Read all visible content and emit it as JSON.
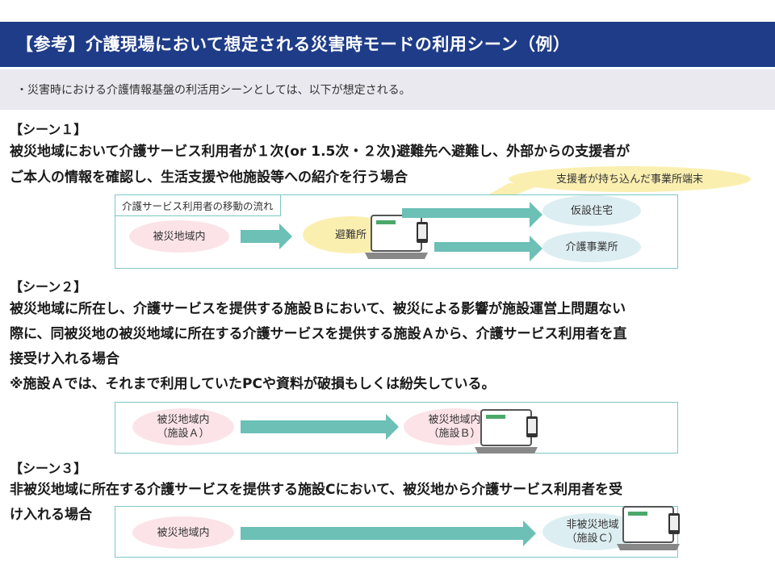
{
  "header": {
    "title": "【参考】介護現場において想定される災害時モードの利用シーン（例）"
  },
  "intro": "・災害時における介護情報基盤の利活用シーンとしては、以下が想定される。",
  "scene1": {
    "heading": "【シーン１】",
    "lines": [
      "被災地域において介護サービス利用者が１次(or  1.5次・２次)避難先へ避難し、外部からの支援者が",
      "ご本人の情報を確認し、生活支援や他施設等への紹介を行う場合"
    ],
    "callout": "支援者が持ち込んだ事業所端末",
    "flow_label": "介護サービス利用者の移動の流れ",
    "from": "被災地域内",
    "middle": "避難所",
    "dest1": "仮設住宅",
    "dest2": "介護事業所"
  },
  "scene2": {
    "heading": "【シーン２】",
    "lines": [
      "被災地域に所在し、介護サービスを提供する施設Ｂにおいて、被災による影響が施設運営上問題ない",
      "際に、同被災地の被災地域に所在する介護サービスを提供する施設Ａから、介護サービス利用者を直",
      "接受け入れる場合",
      "※施設Ａでは、それまで利用していたPCや資料が破損もしくは紛失している。"
    ],
    "from_line1": "被災地域内",
    "from_line2": "（施設Ａ）",
    "to_line1": "被災地域内",
    "to_line2": "（施設Ｂ）"
  },
  "scene3": {
    "heading": "【シーン３】",
    "lines": [
      "非被災地域に所在する介護サービスを提供する施設Cにおいて、被災地から介護サービス利用者を受",
      "け入れる場合"
    ],
    "from": "被災地域内",
    "to_line1": "非被災地域",
    "to_line2": "（施設Ｃ）"
  },
  "device": {
    "screen_text": "介護情報サービス"
  },
  "colors": {
    "header": "#1f3c88",
    "arrow": "#6cc0b6",
    "frame": "#7fc8c2",
    "pink": "#fbe3e8",
    "yellow": "#fbefb0",
    "blue": "#ddeef2"
  }
}
